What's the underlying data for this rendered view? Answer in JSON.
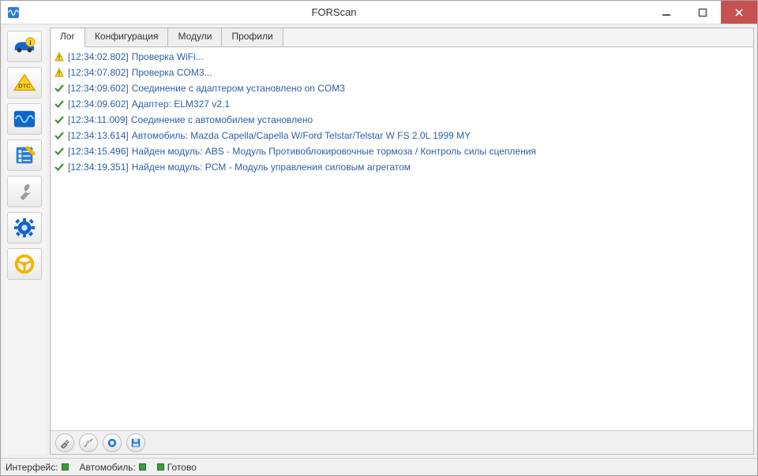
{
  "window": {
    "title": "FORScan",
    "icon": "oscilloscope-app-icon"
  },
  "tabs": [
    {
      "label": "Лог",
      "active": true
    },
    {
      "label": "Конфигурация",
      "active": false
    },
    {
      "label": "Модули",
      "active": false
    },
    {
      "label": "Профили",
      "active": false
    }
  ],
  "sidebar": {
    "buttons": [
      {
        "name": "vehicle-info-button",
        "icon": "car-info-icon"
      },
      {
        "name": "dtc-button",
        "icon": "dtc-icon"
      },
      {
        "name": "oscilloscope-button",
        "icon": "oscilloscope-icon"
      },
      {
        "name": "tests-button",
        "icon": "checklist-icon"
      },
      {
        "name": "service-button",
        "icon": "wrench-icon"
      },
      {
        "name": "settings-button",
        "icon": "gear-icon"
      },
      {
        "name": "steering-button",
        "icon": "steering-wheel-icon"
      }
    ]
  },
  "log": [
    {
      "kind": "warn",
      "ts": "[12:34:02.802]",
      "text": "Проверка WiFi..."
    },
    {
      "kind": "warn",
      "ts": "[12:34:07.802]",
      "text": "Проверка COM3..."
    },
    {
      "kind": "ok",
      "ts": "[12:34:09.602]",
      "text": "Соединение с адаптером установлено on COM3"
    },
    {
      "kind": "ok",
      "ts": "[12:34:09.602]",
      "text": "Адаптер:  ELM327 v2.1"
    },
    {
      "kind": "ok",
      "ts": "[12:34:11.009]",
      "text": "Соединение с автомобилем установлено"
    },
    {
      "kind": "ok",
      "ts": "[12:34:13.614]",
      "text": "Автомобиль: Mazda Capella/Capella W/Ford Telstar/Telstar W FS 2.0L 1999 MY"
    },
    {
      "kind": "ok",
      "ts": "[12:34:15.496]",
      "text": "Найден модуль:  ABS - Модуль Противоблокировочные тормоза / Контроль силы сцепления"
    },
    {
      "kind": "ok",
      "ts": "[12:34:19.351]",
      "text": "Найден модуль:  PCM - Модуль управления силовым агрегатом"
    }
  ],
  "bottom_toolbar": {
    "buttons": [
      {
        "name": "connect-button",
        "icon": "plug-icon"
      },
      {
        "name": "disconnect-button",
        "icon": "unplug-icon"
      },
      {
        "name": "stop-button",
        "icon": "stop-icon"
      },
      {
        "name": "save-button",
        "icon": "save-icon"
      }
    ]
  },
  "status": {
    "interface_label": "Интерфейс:",
    "vehicle_label": "Автомобиль:",
    "ready_label": "Готово"
  },
  "colors": {
    "log_text": "#2a5faa",
    "close_btn": "#c75050",
    "led_green": "#3a9c3a"
  }
}
